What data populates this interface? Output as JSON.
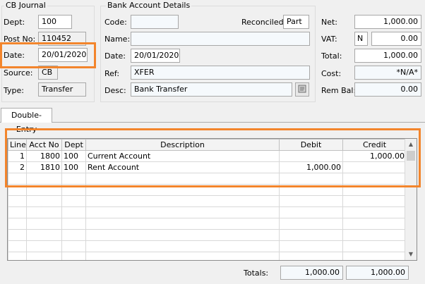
{
  "journal": {
    "title": "CB Journal",
    "dept_label": "Dept:",
    "dept": "100",
    "postno_label": "Post No:",
    "postno": "110452",
    "date_label": "Date:",
    "date": "20/01/2020",
    "source_label": "Source:",
    "source": "CB",
    "type_label": "Type:",
    "type": "Transfer"
  },
  "bank": {
    "title": "Bank Account Details",
    "code_label": "Code:",
    "code": "",
    "reconciled_label": "Reconciled:",
    "reconciled": "Part",
    "name_label": "Name:",
    "name": "",
    "date_label": "Date:",
    "date": "20/01/2020",
    "ref_label": "Ref:",
    "ref": "XFER",
    "desc_label": "Desc:",
    "desc": "Bank Transfer"
  },
  "totals_panel": {
    "net_label": "Net:",
    "net": "1,000.00",
    "vat_label": "VAT:",
    "vat_code": "N",
    "vat": "0.00",
    "total_label": "Total:",
    "total": "1,000.00",
    "cost_label": "Cost:",
    "cost": "*N/A*",
    "rembal_label": "Rem Bal:",
    "rembal": "0.00"
  },
  "tabs": [
    {
      "label": "Double-Entry"
    }
  ],
  "grid": {
    "columns": [
      "Line",
      "Acct No",
      "Dept",
      "Description",
      "Debit",
      "Credit"
    ],
    "rows": [
      {
        "line": "1",
        "acct": "1800",
        "dept": "100",
        "desc": "Current Account",
        "debit": "",
        "credit": "1,000.00"
      },
      {
        "line": "2",
        "acct": "1810",
        "dept": "100",
        "desc": "Rent Account",
        "debit": "1,000.00",
        "credit": ""
      }
    ]
  },
  "footer": {
    "totals_label": "Totals:",
    "debit_total": "1,000.00",
    "credit_total": "1,000.00"
  },
  "colors": {
    "highlight": "#f3852c"
  }
}
